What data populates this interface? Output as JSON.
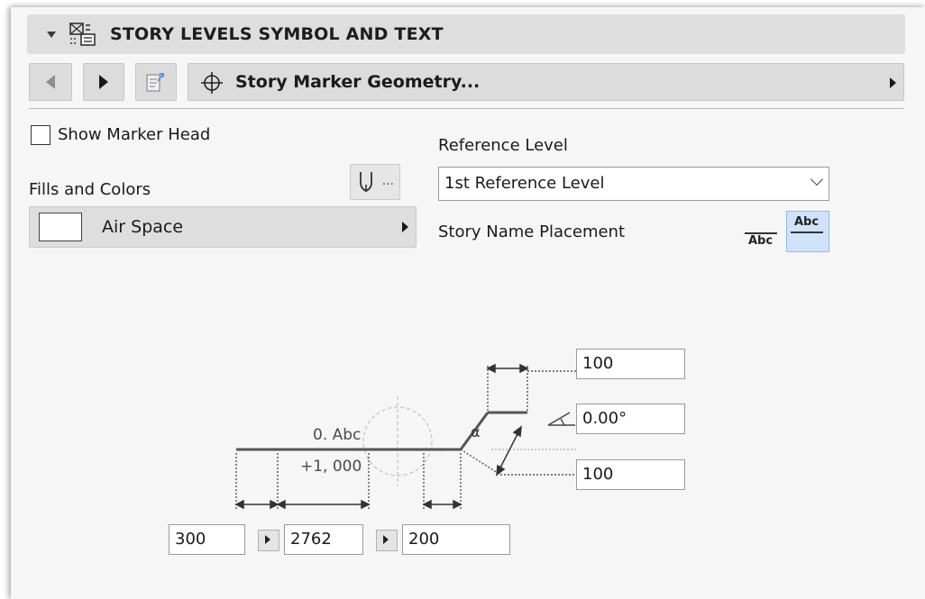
{
  "section": {
    "title": "STORY LEVELS SYMBOL AND TEXT",
    "icon": "story-levels-icon"
  },
  "nav": {
    "prev_icon": "triangle-left-icon",
    "next_icon": "triangle-right-icon",
    "doc_icon": "document-arrow-icon",
    "page_icon": "crosshair-icon",
    "page_label": "Story Marker Geometry..."
  },
  "left": {
    "show_marker_head_label": "Show Marker Head",
    "show_marker_head_checked": false,
    "fills_label": "Fills and Colors",
    "pen_icon": "pen-icon",
    "pen_ellipsis": "...",
    "fill_value": "Air Space",
    "fill_swatch_color": "#ffffff"
  },
  "right": {
    "reference_label": "Reference Level",
    "reference_value": "1st Reference Level",
    "placement_label": "Story Name Placement",
    "placement_below_text": "Abc",
    "placement_above_text": "Abc",
    "placement_selected": "above",
    "selected_color": "#cfe4fb"
  },
  "diagram": {
    "story_name": "0. Abc",
    "elevation": "+1, 000",
    "angle_symbol": "α",
    "top_length": "100",
    "angle": "0.00°",
    "bottom_length": "100",
    "dim1": "300",
    "dim2": "2762",
    "dim3": "200"
  }
}
